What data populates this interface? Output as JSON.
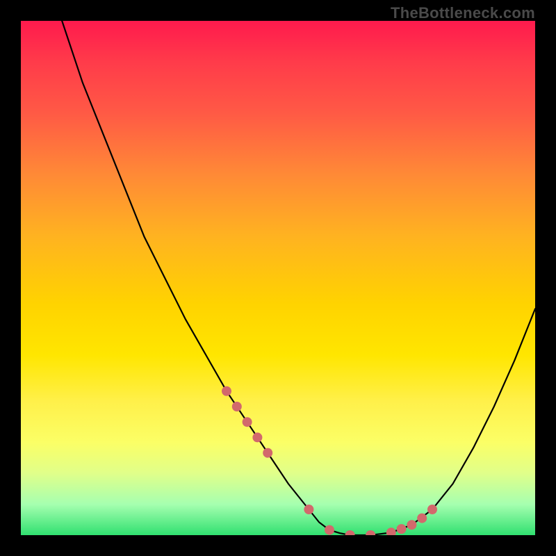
{
  "watermark": "TheBottleneck.com",
  "colors": {
    "dot": "#d2696c",
    "curve": "#000000",
    "background": "#000000"
  },
  "chart_data": {
    "type": "line",
    "title": "",
    "xlabel": "",
    "ylabel": "",
    "xlim": [
      0,
      100
    ],
    "ylim": [
      0,
      100
    ],
    "grid": false,
    "legend": false,
    "note": "Bottleneck-style V-curve. x is a normalized device axis (0–100); y is bottleneck % (0 = perfect balance, 100 = maximum bottleneck). Values estimated from pixel positions; no axis ticks shown in source image.",
    "series": [
      {
        "name": "bottleneck_curve",
        "x": [
          0,
          4,
          8,
          12,
          16,
          20,
          24,
          28,
          32,
          36,
          40,
          44,
          48,
          52,
          56,
          58,
          60,
          62,
          64,
          68,
          72,
          76,
          80,
          84,
          88,
          92,
          96,
          100
        ],
        "y": [
          130,
          112,
          100,
          88,
          78,
          68,
          58,
          50,
          42,
          35,
          28,
          22,
          16,
          10,
          5,
          2.5,
          1,
          0.4,
          0,
          0,
          0.5,
          2,
          5,
          10,
          17,
          25,
          34,
          44
        ]
      }
    ],
    "highlight_dots": {
      "name": "sample_points",
      "x": [
        40,
        42,
        44,
        46,
        48,
        56,
        60,
        64,
        68,
        72,
        74,
        76,
        78,
        80
      ],
      "y": [
        28,
        25,
        22,
        19,
        16,
        5,
        1,
        0,
        0,
        0.5,
        1.2,
        2,
        3.3,
        5
      ]
    }
  }
}
